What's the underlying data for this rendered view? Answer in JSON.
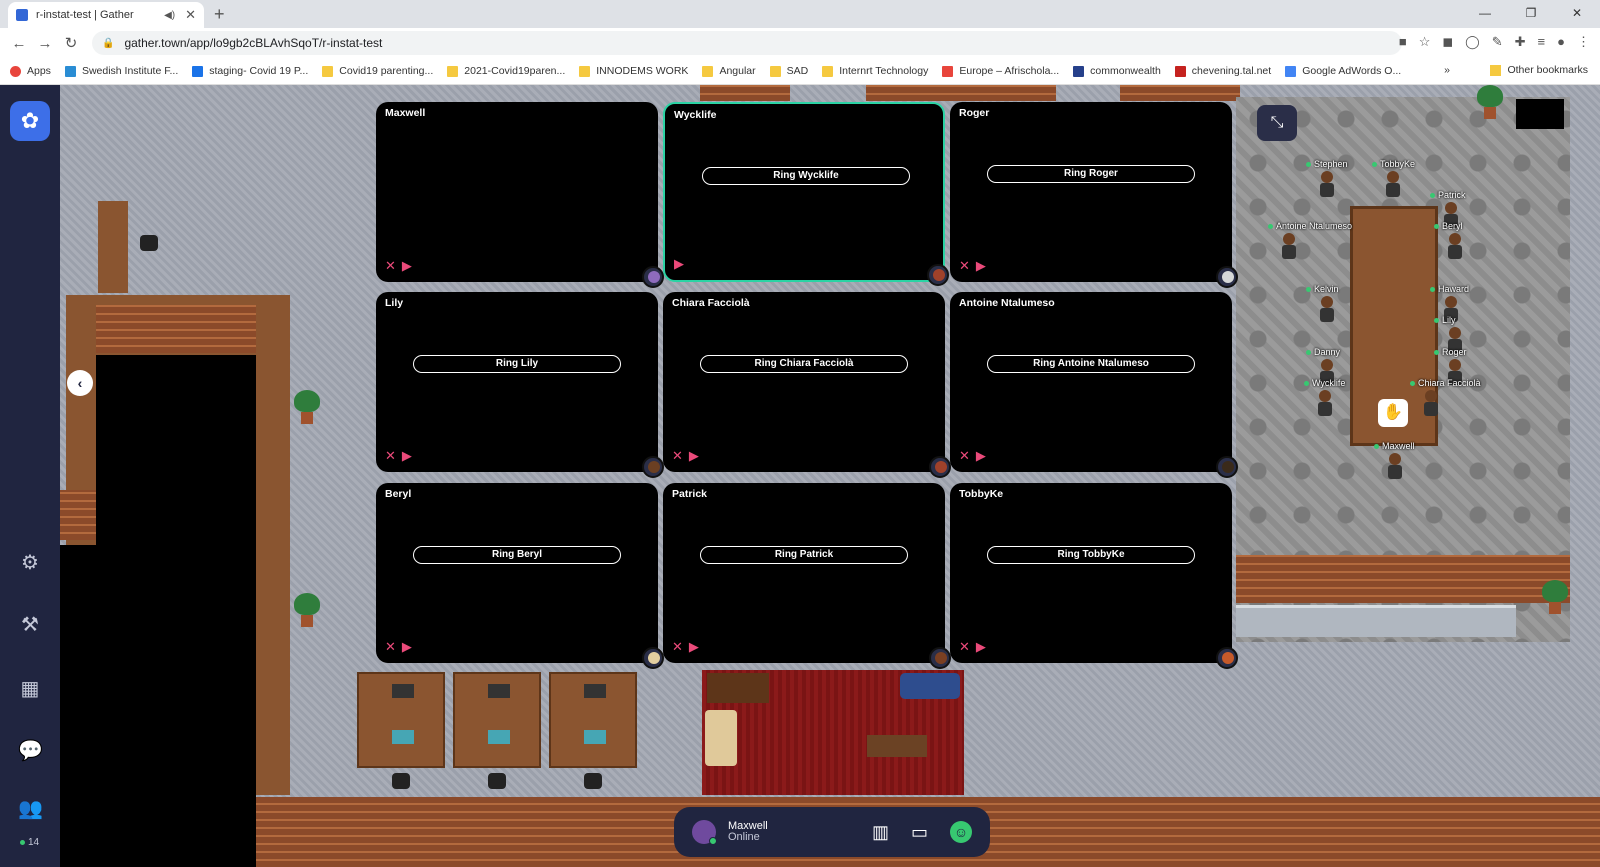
{
  "browser": {
    "tab_title": "r-instat-test | Gather",
    "url": "gather.town/app/lo9gb2cBLAvhSqoT/r-instat-test",
    "bookmarks": [
      {
        "label": "Apps",
        "color": "#e8453c"
      },
      {
        "label": "Swedish Institute F...",
        "color": "#2a8dd4"
      },
      {
        "label": "staging- Covid 19 P...",
        "color": "#1a73e8"
      },
      {
        "label": "Covid19 parenting...",
        "color": "#f5c940"
      },
      {
        "label": "2021-Covid19paren...",
        "color": "#f5c940"
      },
      {
        "label": "INNODEMS WORK",
        "color": "#f5c940"
      },
      {
        "label": "Angular",
        "color": "#f5c940"
      },
      {
        "label": "SAD",
        "color": "#f5c940"
      },
      {
        "label": "Internrt Technology",
        "color": "#f5c940"
      },
      {
        "label": "Europe – Afrischola...",
        "color": "#e8453c"
      },
      {
        "label": "commonwealth",
        "color": "#26408b"
      },
      {
        "label": "chevening.tal.net",
        "color": "#c5221f"
      },
      {
        "label": "Google AdWords O...",
        "color": "#4285f4"
      }
    ],
    "other_bookmarks": "Other bookmarks",
    "more_bookmarks": "»"
  },
  "video_grid": [
    {
      "name": "Maxwell",
      "ring": "",
      "active": false,
      "avatar": "#8e6bbd"
    },
    {
      "name": "Wycklife",
      "ring": "Ring Wycklife",
      "active": true,
      "avatar": "#a0412a"
    },
    {
      "name": "Roger",
      "ring": "Ring Roger",
      "active": false,
      "avatar": "#d6d8d8"
    },
    {
      "name": "Lily",
      "ring": "Ring Lily",
      "active": false,
      "avatar": "#6b3f22"
    },
    {
      "name": "Chiara Facciolà",
      "ring": "Ring Chiara Facciolà",
      "active": false,
      "avatar": "#a0412a"
    },
    {
      "name": "Antoine Ntalumeso",
      "ring": "Ring Antoine Ntalumeso",
      "active": false,
      "avatar": "#3a2a1a"
    },
    {
      "name": "Beryl",
      "ring": "Ring Beryl",
      "active": false,
      "avatar": "#e3cfa0"
    },
    {
      "name": "Patrick",
      "ring": "Ring Patrick",
      "active": false,
      "avatar": "#7a3f22"
    },
    {
      "name": "TobbyKe",
      "ring": "Ring TobbyKe",
      "active": false,
      "avatar": "#c65a2a"
    }
  ],
  "map_people": [
    {
      "name": "Stephen"
    },
    {
      "name": "TobbyKe"
    },
    {
      "name": "Patrick"
    },
    {
      "name": "Antoine Ntalumeso"
    },
    {
      "name": "Beryl"
    },
    {
      "name": "Kelvin"
    },
    {
      "name": "Haward"
    },
    {
      "name": "Lily"
    },
    {
      "name": "Danny"
    },
    {
      "name": "Roger"
    },
    {
      "name": "Wycklife"
    },
    {
      "name": "Chiara Facciolà"
    },
    {
      "name": "Maxwell"
    }
  ],
  "sidebar": {
    "participant_count": "14"
  },
  "bottom_bar": {
    "user_name": "Maxwell",
    "status": "Online"
  },
  "icons": {
    "mic_off": "🎙",
    "cam_off": "🎥"
  }
}
